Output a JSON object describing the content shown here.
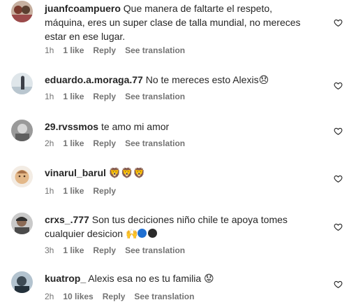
{
  "comments": [
    {
      "username": "juanfcoampuero",
      "text": "Que manera de faltarte el respeto, máquina, eres un super clase de talla mundial, no mereces estar en ese lugar.",
      "time": "1h",
      "likes": "1 like",
      "reply": "Reply",
      "translate": "See translation",
      "avatar_color": "#9b4a4a"
    },
    {
      "username": "eduardo.a.moraga.77",
      "text": "No te mereces esto Alexis",
      "emoji": "😞",
      "time": "1h",
      "likes": "1 like",
      "reply": "Reply",
      "translate": "See translation",
      "avatar_color": "#b9c6cf"
    },
    {
      "username": "29.rvssmos",
      "text": "te amo mi amor",
      "time": "2h",
      "likes": "1 like",
      "reply": "Reply",
      "translate": "See translation",
      "avatar_color": "#8a8a8a"
    },
    {
      "username": "vinarul_barul",
      "text": "",
      "emoji": "🦁🦁🦁",
      "time": "1h",
      "likes": "1 like",
      "reply": "Reply",
      "avatar_color": "#d8b79a"
    },
    {
      "username": "crxs_.777",
      "text": "Son tus deciciones niño chile te apoya tomes cualquier desicion",
      "emoji": "🙌",
      "time": "3h",
      "likes": "1 like",
      "reply": "Reply",
      "translate": "See translation",
      "avatar_color": "#6b6b6b",
      "circle_colors": [
        "#1f6fd1",
        "#2b2b2b"
      ]
    },
    {
      "username": "kuatrop_",
      "text": "Alexis esa no es tu familia",
      "emoji": "😟",
      "time": "2h",
      "likes": "10 likes",
      "reply": "Reply",
      "translate": "See translation",
      "avatar_color": "#4d5f6b"
    }
  ],
  "icons": {
    "like": "heart-outline-icon"
  },
  "colors": {
    "text": "#262626",
    "muted": "#737373"
  }
}
